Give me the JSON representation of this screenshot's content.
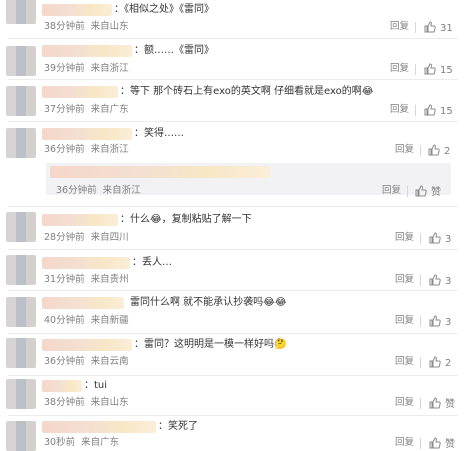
{
  "comments": [
    {
      "text": "：《相似之处》《雷同》",
      "time": "38分钟前",
      "loc": "来自山东",
      "reply": "回复",
      "likes": "31"
    },
    {
      "text": "：额……《雷同》",
      "time": "39分钟前",
      "loc": "来自浙江",
      "reply": "回复",
      "likes": "15"
    },
    {
      "text": "：等下 那个砖石上有exo的英文啊 仔细看就是exo的啊😂",
      "time": "37分钟前",
      "loc": "来自广东",
      "reply": "回复",
      "likes": "15"
    },
    {
      "text": "：笑得……",
      "time": "36分钟前",
      "loc": "来自浙江",
      "reply": "回复",
      "likes": "2",
      "sub": {
        "time": "36分钟前",
        "loc": "来自浙江",
        "reply": "回复",
        "likes": "赞"
      }
    },
    {
      "text": "：什么😂，复制粘贴了解一下",
      "time": "28分钟前",
      "loc": "来自四川",
      "reply": "回复",
      "likes": "3"
    },
    {
      "text": "：丢人…",
      "time": "31分钟前",
      "loc": "来自贵州",
      "reply": "回复",
      "likes": "3"
    },
    {
      "text": "雷同什么啊 就不能承认抄袭吗😂😂",
      "time": "40分钟前",
      "loc": "来自新疆",
      "reply": "回复",
      "likes": "3"
    },
    {
      "text": "：雷同？这明明是一模一样好吗🤔",
      "time": "36分钟前",
      "loc": "来自云南",
      "reply": "回复",
      "likes": "2"
    },
    {
      "text": "：tui",
      "time": "38分钟前",
      "loc": "来自山东",
      "reply": "回复",
      "likes": "赞"
    },
    {
      "text": "：笑死了",
      "time": "30秒前",
      "loc": "来自广东",
      "reply": "回复",
      "likes": "赞"
    }
  ]
}
